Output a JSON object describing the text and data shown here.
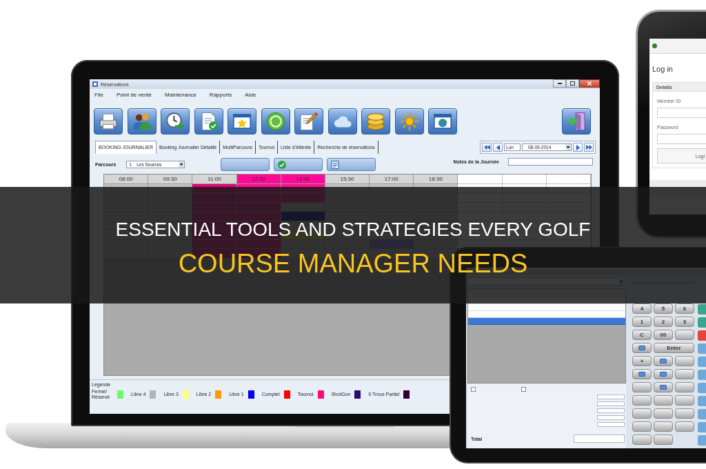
{
  "banner": {
    "line_1": "ESSENTIAL TOOLS AND STRATEGIES EVERY GOLF",
    "line_2": "COURSE MANAGER NEEDS"
  },
  "laptop": {
    "window": {
      "title": "Réservations"
    },
    "menu": [
      "File",
      "Point de vente",
      "Maintenance",
      "Rapports",
      "Aide"
    ],
    "toolbar": [
      {
        "kind": "printer"
      },
      {
        "kind": "people"
      },
      {
        "kind": "clock"
      },
      {
        "kind": "document"
      },
      {
        "kind": "star"
      },
      {
        "kind": "coin"
      },
      {
        "kind": "pencil"
      },
      {
        "kind": "cloud"
      },
      {
        "kind": "coins"
      },
      {
        "kind": "sun"
      },
      {
        "kind": "globe"
      },
      {
        "kind": "exit"
      }
    ],
    "tabs": [
      {
        "label": "BOOKING JOURNALIER",
        "selected": true
      },
      {
        "label": "Booking Journalier Détaillé",
        "selected": false
      },
      {
        "label": "MultiParcours",
        "selected": false
      },
      {
        "label": "Tournoi",
        "selected": false
      },
      {
        "label": "Liste d'Attente",
        "selected": false
      },
      {
        "label": "Recherche de réservations",
        "selected": false
      }
    ],
    "date_nav": {
      "day": "Lun",
      "date": "08-09-2014"
    },
    "course": {
      "label": "Parcours",
      "code": "1",
      "name": "Les Sources"
    },
    "actions": [
      {
        "kind": "plain"
      },
      {
        "kind": "check"
      },
      {
        "kind": "document"
      }
    ],
    "notes": {
      "label": "Notes de la Journée"
    },
    "grid": {
      "top_row": [
        {
          "time": "08:00",
          "kind": "free"
        },
        {
          "time": "09:30",
          "kind": "free"
        },
        {
          "time": "11:00",
          "kind": "free"
        },
        {
          "time": "12:30",
          "kind": "tournament"
        },
        {
          "time": "14:00",
          "kind": "tournament"
        },
        {
          "time": "15:30",
          "kind": "free"
        },
        {
          "time": "17:00",
          "kind": "free"
        },
        {
          "time": "18:30",
          "kind": "free"
        }
      ],
      "covered_rows": [
        [
          {
            "kind": "free"
          },
          {
            "kind": "free"
          },
          {
            "kind": "blocked"
          },
          {
            "kind": "tournament"
          },
          {
            "kind": "tournament"
          },
          {
            "kind": "free"
          },
          {
            "kind": "free"
          },
          {
            "kind": "free"
          }
        ],
        [
          {
            "kind": "free"
          },
          {
            "kind": "free"
          },
          {
            "kind": "blocked"
          },
          {
            "kind": "tournament"
          },
          {
            "kind": "tournament"
          },
          {
            "kind": "free"
          },
          {
            "kind": "free"
          },
          {
            "kind": "free"
          }
        ],
        [
          {
            "kind": "free"
          },
          {
            "kind": "free"
          },
          {
            "kind": "blocked"
          },
          {
            "kind": "blocked"
          },
          {
            "kind": "free"
          },
          {
            "kind": "free"
          },
          {
            "kind": "free"
          },
          {
            "kind": "free"
          }
        ],
        [
          {
            "kind": "free"
          },
          {
            "kind": "free"
          },
          {
            "kind": "blocked"
          },
          {
            "kind": "blocked"
          },
          {
            "kind": "booked"
          },
          {
            "kind": "free"
          },
          {
            "kind": "free"
          },
          {
            "kind": "free"
          }
        ],
        [
          {
            "kind": "free"
          },
          {
            "kind": "free"
          },
          {
            "kind": "blocked"
          },
          {
            "kind": "blocked"
          },
          {
            "kind": "free"
          },
          {
            "kind": "free"
          },
          {
            "kind": "free"
          },
          {
            "kind": "free"
          }
        ],
        [
          {
            "kind": "free"
          },
          {
            "kind": "free"
          },
          {
            "kind": "blocked"
          },
          {
            "kind": "blocked"
          },
          {
            "kind": "partial"
          },
          {
            "kind": "free"
          },
          {
            "kind": "free"
          },
          {
            "kind": "free"
          }
        ],
        [
          {
            "kind": "free"
          },
          {
            "kind": "free"
          },
          {
            "kind": "blocked"
          },
          {
            "kind": "blocked"
          },
          {
            "kind": "free"
          },
          {
            "kind": "free"
          },
          {
            "kind": "selected"
          },
          {
            "kind": "free"
          }
        ],
        [
          {
            "kind": "free"
          },
          {
            "kind": "free"
          },
          {
            "kind": "blocked"
          },
          {
            "kind": "blocked"
          },
          {
            "kind": "free"
          },
          {
            "kind": "free"
          },
          {
            "kind": "free"
          },
          {
            "kind": "free"
          }
        ]
      ]
    },
    "legend": {
      "title": "Légende",
      "items": [
        {
          "label": "Fermé/ Réservé",
          "color": "#66ff66"
        },
        {
          "label": "Libre 4",
          "color": "#b4b4b4"
        },
        {
          "label": "Libre 3",
          "color": "#ffff80"
        },
        {
          "label": "Libre 2",
          "color": "#ff9900"
        },
        {
          "label": "Libre 1",
          "color": "#0000ee"
        },
        {
          "label": "Complet",
          "color": "#ff0000"
        },
        {
          "label": "Tournoi",
          "color": "#ff0a78"
        },
        {
          "label": "ShotGun",
          "color": "#2a0a6e"
        },
        {
          "label": "9 Trous Partiel",
          "color": "#330033"
        }
      ]
    }
  },
  "phone": {
    "heading": "Log in",
    "panel_title": "Details",
    "fields": [
      {
        "label": "Member ID"
      },
      {
        "label": "Password"
      }
    ],
    "button": "Logi"
  },
  "tablet": {
    "order_rows": [
      {
        "selected": false
      },
      {
        "selected": false
      },
      {
        "selected": false
      },
      {
        "selected": true
      }
    ],
    "options": [
      {
        "checked": false
      },
      {
        "checked": false
      }
    ],
    "total_label": "Total",
    "keypad": [
      {
        "kind": "key",
        "label": "4"
      },
      {
        "kind": "key",
        "label": "5"
      },
      {
        "kind": "key",
        "label": "6"
      },
      {
        "kind": "key",
        "label": "1"
      },
      {
        "kind": "key",
        "label": "2"
      },
      {
        "kind": "key",
        "label": "3"
      },
      {
        "kind": "key",
        "label": "C"
      },
      {
        "kind": "key",
        "label": "00"
      },
      {
        "kind": "blank"
      },
      {
        "kind": "icon"
      },
      {
        "kind": "wide",
        "label": "Enter"
      },
      {
        "kind": "key",
        "label": "+"
      },
      {
        "kind": "icon"
      },
      {
        "kind": "blank"
      },
      {
        "kind": "icon"
      },
      {
        "kind": "icon"
      },
      {
        "kind": "blank"
      },
      {
        "kind": "blank"
      },
      {
        "kind": "icon"
      },
      {
        "kind": "blank"
      },
      {
        "kind": "blank"
      },
      {
        "kind": "blank"
      },
      {
        "kind": "blank"
      },
      {
        "kind": "blank"
      },
      {
        "kind": "blank"
      },
      {
        "kind": "blank"
      },
      {
        "kind": "blank"
      },
      {
        "kind": "blank"
      },
      {
        "kind": "blank"
      },
      {
        "kind": "blank"
      },
      {
        "kind": "blank"
      }
    ],
    "side_buttons": [
      {
        "color": "#3aa58f"
      },
      {
        "color": "#3aa58f"
      },
      {
        "color": "#e2453f"
      },
      {
        "color": "#6fa9dc"
      },
      {
        "color": "#6fa9dc"
      },
      {
        "color": "#6fa9dc"
      },
      {
        "color": "#6fa9dc"
      },
      {
        "color": "#6fa9dc"
      },
      {
        "color": "#6fa9dc"
      },
      {
        "color": "#6fa9dc"
      },
      {
        "color": "#6fa9dc"
      }
    ]
  }
}
